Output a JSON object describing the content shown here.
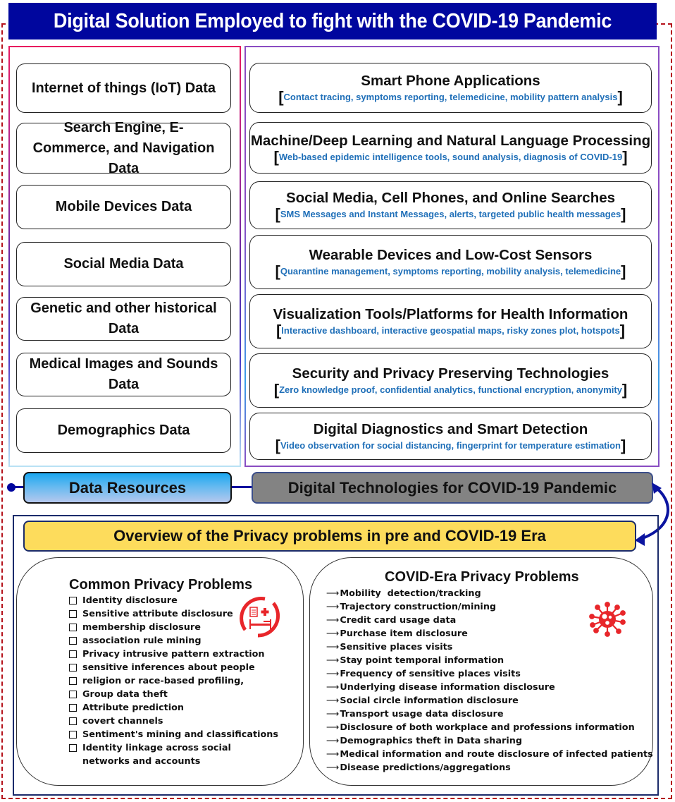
{
  "title": "Digital Solution Employed to fight with the COVID-19 Pandemic",
  "data_resources": {
    "label": "Data Resources",
    "items": [
      {
        "label": "Internet of things (IoT) Data"
      },
      {
        "label": "Search Engine, E-Commerce, and Navigation Data"
      },
      {
        "label": "Mobile Devices Data"
      },
      {
        "label": "Social Media Data"
      },
      {
        "label": "Genetic and other historical Data"
      },
      {
        "label": "Medical Images and Sounds Data"
      },
      {
        "label": "Demographics Data"
      }
    ]
  },
  "digital_technologies": {
    "label": "Digital Technologies for COVID-19 Pandemic",
    "items": [
      {
        "title": "Smart Phone Applications",
        "subtitle": "Contact tracing, symptoms reporting, telemedicine, mobility pattern analysis"
      },
      {
        "title": "Machine/Deep Learning and Natural Language Processing",
        "subtitle": "Web-based epidemic intelligence tools, sound analysis, diagnosis of COVID-19"
      },
      {
        "title": "Social Media, Cell Phones, and Online Searches",
        "subtitle": "SMS Messages and Instant Messages, alerts, targeted public health messages"
      },
      {
        "title": "Wearable Devices and Low-Cost Sensors",
        "subtitle": "Quarantine management, symptoms reporting, mobility analysis, telemedicine"
      },
      {
        "title": "Visualization Tools/Platforms for Health Information",
        "subtitle": "Interactive dashboard, interactive geospatial maps, risky zones plot, hotspots"
      },
      {
        "title": "Security and Privacy Preserving Technologies",
        "subtitle": "Zero knowledge proof, confidential analytics, functional encryption, anonymity"
      },
      {
        "title": "Digital Diagnostics and Smart Detection",
        "subtitle": "Video observation for social distancing, fingerprint for temperature estimation"
      }
    ]
  },
  "privacy_overview": {
    "label": "Overview of the Privacy problems in pre and COVID-19 Era",
    "common": {
      "title": "Common Privacy Problems",
      "icon": "hospital-bed-icon",
      "items": [
        "Identity disclosure",
        " Sensitive attribute disclosure",
        "membership disclosure",
        "association rule mining",
        "Privacy intrusive pattern extraction",
        "sensitive inferences about people",
        "religion or race-based profiling,",
        "Group data theft",
        "Attribute prediction",
        "covert channels",
        "Sentiment's mining and classifications",
        "Identity linkage across social networks and accounts"
      ]
    },
    "covid": {
      "title": "COVID-Era Privacy Problems",
      "icon": "virus-icon",
      "arrow": "⟶",
      "items": [
        "Mobility  detection/tracking",
        "Trajectory construction/mining",
        "Credit card usage data",
        "Purchase item disclosure",
        "Sensitive places visits",
        "Stay point temporal information",
        "Frequency of sensitive places visits",
        "Underlying disease information disclosure",
        "Social circle information disclosure",
        "Transport usage data disclosure",
        "Disclosure of both workplace and professions information",
        "Demographics theft in Data sharing",
        "Medical information and route disclosure of infected patients",
        "Disease predictions/aggregations"
      ]
    }
  },
  "colors": {
    "title_bg": "#00069e",
    "outer_dash": "#b5121b",
    "subtitle_text": "#1f6fb8",
    "overview_bg": "#fddc5c",
    "digital_tech_bg": "#838383",
    "icon_red": "#e8262a"
  }
}
